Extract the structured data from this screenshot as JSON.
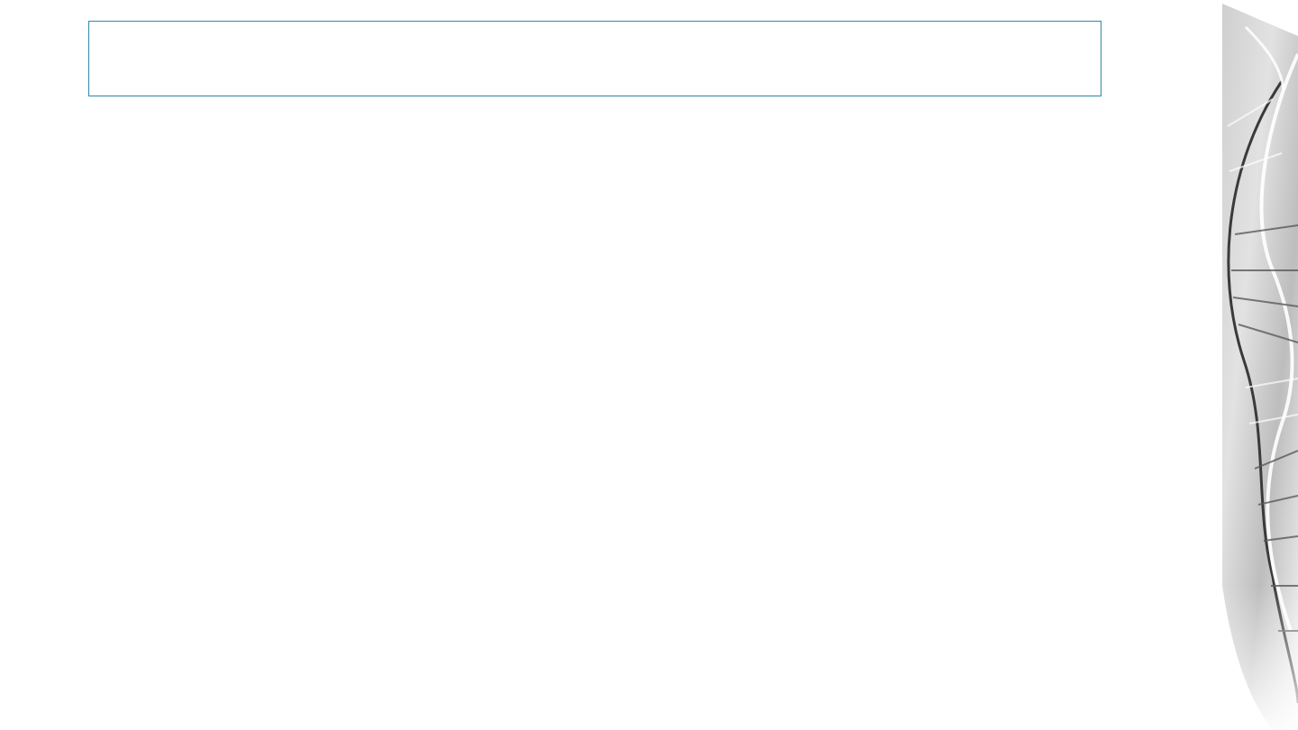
{
  "slide": {
    "title": "",
    "body": ""
  },
  "decoration": {
    "accent_color": "#2a8aa6",
    "side_image_icon": "dna-helix-image"
  }
}
